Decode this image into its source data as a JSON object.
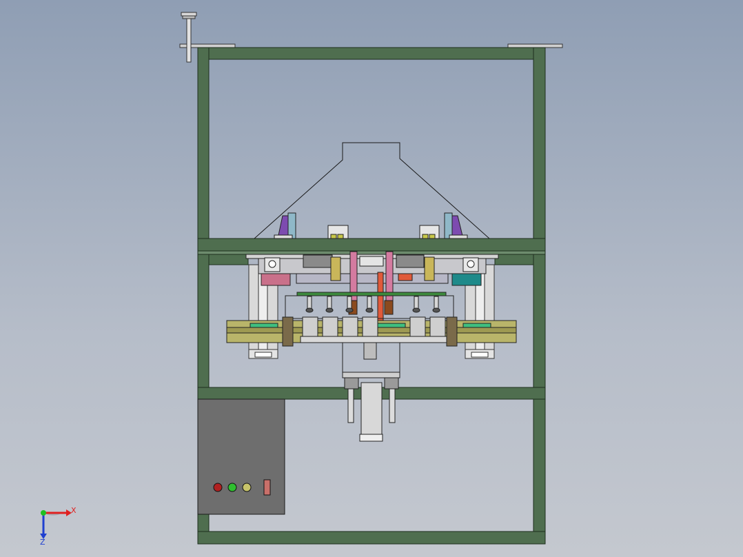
{
  "view": {
    "background_top": "#8f9eb4",
    "background_bottom": "#c4c8cf"
  },
  "colors": {
    "frame_green": "#4f6e4f",
    "frame_edge": "#1e2e1e",
    "control_box": "#6e6e6e",
    "olive_rail": "#b9b56a",
    "steel": "#c9ccd0",
    "purple": "#7d4bb0",
    "teal": "#1e8a8a",
    "pink": "#c9708a",
    "light_red": "#ff4040",
    "light_green": "#2fbf2f",
    "light_yellow": "#c7c36a"
  },
  "control_panel": {
    "lights": [
      "red",
      "green",
      "yellow"
    ],
    "switch": "rectangular"
  },
  "triad": {
    "x_label": "X",
    "z_label": "Z",
    "x_color": "#e02020",
    "y_color": "#20c020",
    "z_color": "#2040d0"
  }
}
